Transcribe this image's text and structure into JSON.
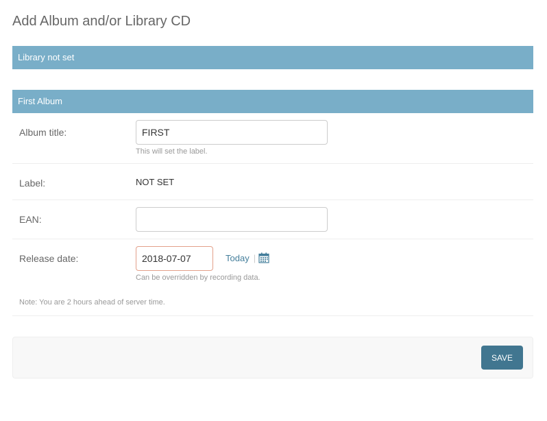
{
  "page": {
    "title": "Add Album and/or Library CD"
  },
  "library_section": {
    "header": "Library not set"
  },
  "album_section": {
    "header": "First Album",
    "album_title": {
      "label": "Album title:",
      "value": "FIRST",
      "help": "This will set the label."
    },
    "label": {
      "label": "Label:",
      "value": "NOT SET"
    },
    "ean": {
      "label": "EAN:",
      "value": ""
    },
    "release_date": {
      "label": "Release date:",
      "value": "2018-07-07",
      "today_label": "Today",
      "separator": "|",
      "calendar_icon": "calendar-icon",
      "help": "Can be overridden by recording data.",
      "timezone_note": "Note: You are 2 hours ahead of server time."
    }
  },
  "submit": {
    "save_label": "SAVE"
  },
  "colors": {
    "header_bg": "#79aec8",
    "link": "#447e9b",
    "button_bg": "#417690",
    "error_border": "#e3a08a"
  }
}
